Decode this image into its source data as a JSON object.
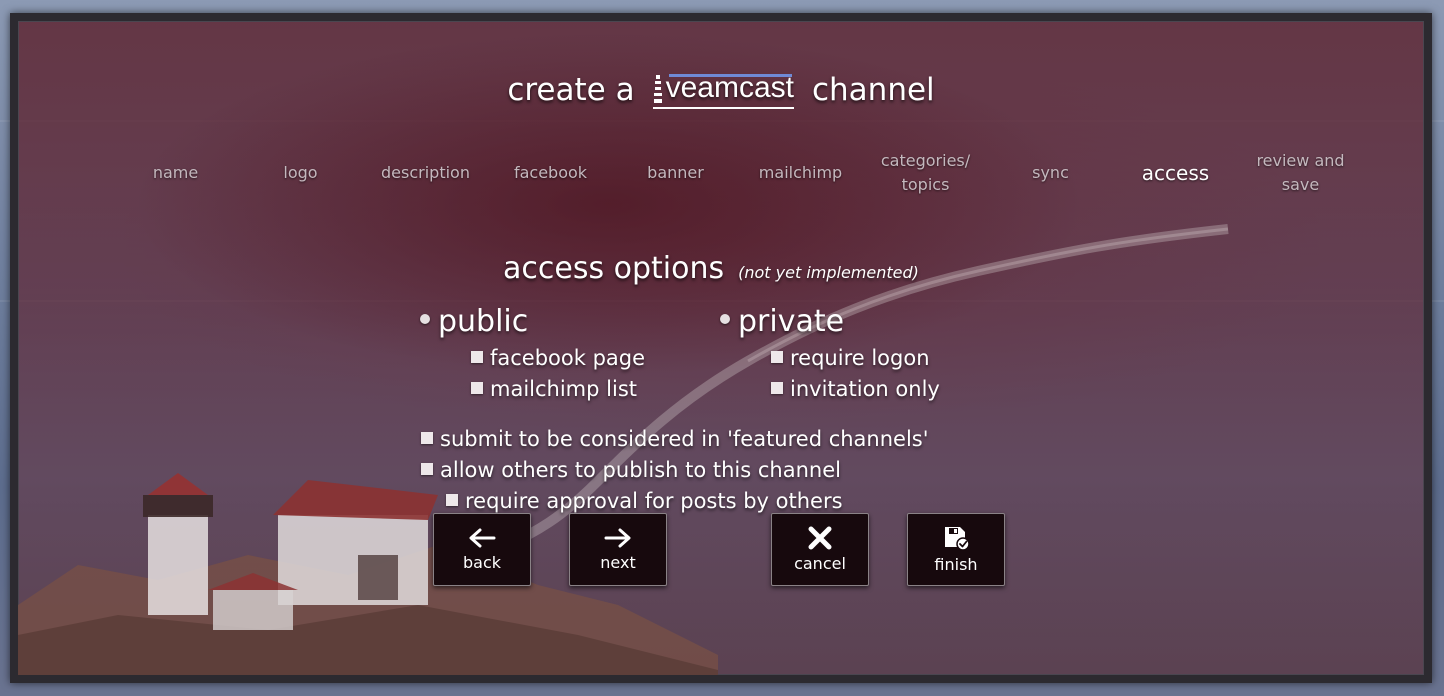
{
  "header": {
    "title_prefix": "create a",
    "logo_text": "veamcast",
    "title_suffix": "channel"
  },
  "steps": [
    {
      "label": "name",
      "active": false
    },
    {
      "label": "logo",
      "active": false
    },
    {
      "label": "description",
      "active": false
    },
    {
      "label": "facebook",
      "active": false
    },
    {
      "label": "banner",
      "active": false
    },
    {
      "label": "mailchimp",
      "active": false
    },
    {
      "label": "categories/ topics",
      "active": false
    },
    {
      "label": "sync",
      "active": false
    },
    {
      "label": "access",
      "active": true
    },
    {
      "label": "review and save",
      "active": false
    }
  ],
  "access": {
    "heading": "access options",
    "note": "(not yet implemented)",
    "public": {
      "label": "public",
      "options": [
        "facebook page",
        "mailchimp list"
      ]
    },
    "private": {
      "label": "private",
      "options": [
        "require logon",
        "invitation only"
      ]
    },
    "extra": [
      "submit to be considered in 'featured channels'",
      "allow others to publish to this channel",
      "require approval for posts by others"
    ]
  },
  "buttons": {
    "back": "back",
    "next": "next",
    "cancel": "cancel",
    "finish": "finish"
  },
  "icons": {
    "back": "arrow-left-icon",
    "next": "arrow-right-icon",
    "cancel": "close-icon",
    "finish": "save-icon"
  }
}
